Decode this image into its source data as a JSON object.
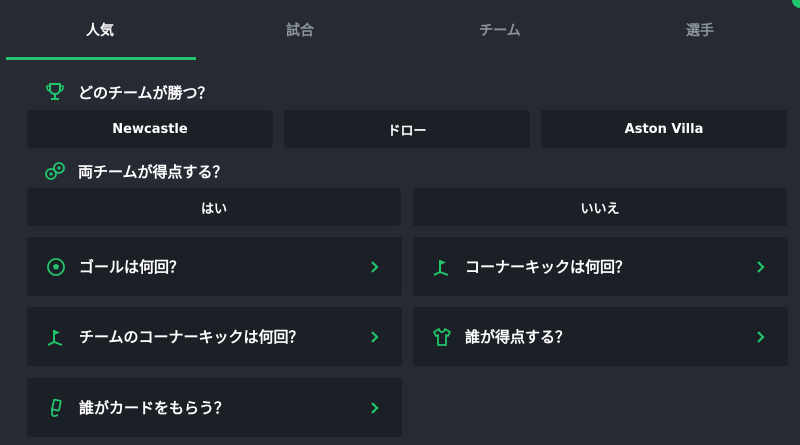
{
  "tabs": [
    {
      "label": "人気",
      "active": true
    },
    {
      "label": "試合",
      "active": false
    },
    {
      "label": "チーム",
      "active": false
    },
    {
      "label": "選手",
      "active": false
    }
  ],
  "win_section": {
    "title": "どのチームが勝つ？",
    "icon": "trophy-icon",
    "options": [
      "Newcastle",
      "ドロー",
      "Aston Villa"
    ]
  },
  "btts_section": {
    "title": "両チームが得点する？",
    "icon": "balls-icon",
    "options": [
      "はい",
      "いいえ"
    ]
  },
  "cards": [
    {
      "label": "ゴールは何回？",
      "icon": "soccer-ball-icon"
    },
    {
      "label": "コーナーキックは何回？",
      "icon": "corner-flag-icon"
    },
    {
      "label": "チームのコーナーキックは何回？",
      "icon": "corner-flag-icon"
    },
    {
      "label": "誰が得点する？",
      "icon": "jersey-icon"
    },
    {
      "label": "誰がカードをもらう？",
      "icon": "card-icon"
    }
  ],
  "colors": {
    "background": "#252a33",
    "panel": "#1b1f26",
    "accent": "#22c46b",
    "muted_text": "#8d939d"
  }
}
